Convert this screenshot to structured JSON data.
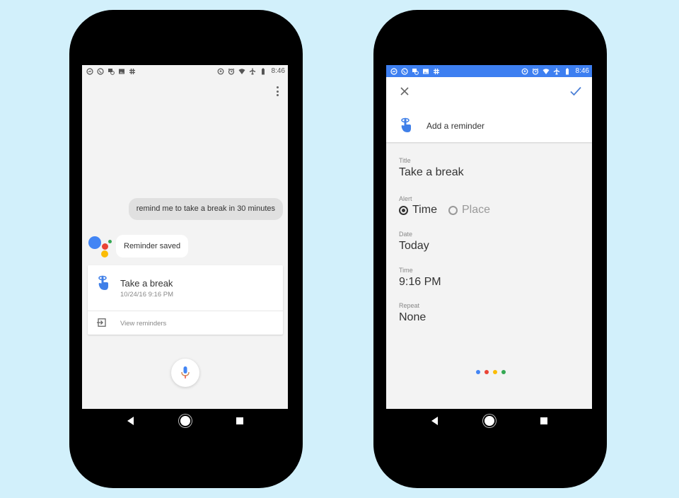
{
  "colors": {
    "background": "#d2f0fb",
    "status_bar_blue": "#3d7ff1",
    "google_blue": "#4285f4",
    "google_red": "#ea4335",
    "google_yellow": "#fbbc05",
    "google_green": "#34a853",
    "reminder_icon_blue": "#3f7fe8"
  },
  "left_phone": {
    "status_bar": {
      "left_icons": [
        "messenger-icon",
        "whatsapp-icon",
        "image-message-icon",
        "gallery-icon",
        "slack-icon"
      ],
      "right_icons": [
        "data-saver-icon",
        "alarm-icon",
        "wifi-icon",
        "airplane-icon",
        "battery-icon"
      ],
      "time": "8:46"
    },
    "conversation": {
      "user_query": "remind me to take a break in 30 minutes",
      "assistant_reply": "Reminder saved"
    },
    "reminder_card": {
      "icon": "reminder-hand-icon",
      "title": "Take a break",
      "datetime": "10/24/16 9:16 PM",
      "action_icon": "open-in-icon",
      "action_label": "View reminders"
    },
    "mic_icon": "microphone-icon",
    "nav": [
      "back",
      "home",
      "recents"
    ]
  },
  "right_phone": {
    "status_bar": {
      "left_icons": [
        "messenger-icon",
        "whatsapp-icon",
        "image-message-icon",
        "gallery-icon",
        "slack-icon"
      ],
      "right_icons": [
        "data-saver-icon",
        "alarm-icon",
        "wifi-icon",
        "airplane-icon",
        "battery-icon"
      ],
      "time": "8:46"
    },
    "dialog": {
      "close_icon": "close-icon",
      "save_icon": "check-icon",
      "header_icon": "reminder-hand-icon",
      "header_title": "Add a reminder"
    },
    "form": {
      "title": {
        "label": "Title",
        "value": "Take a break"
      },
      "alert": {
        "label": "Alert",
        "options": [
          {
            "label": "Time",
            "selected": true
          },
          {
            "label": "Place",
            "selected": false
          }
        ]
      },
      "date": {
        "label": "Date",
        "value": "Today"
      },
      "time": {
        "label": "Time",
        "value": "9:16 PM"
      },
      "repeat": {
        "label": "Repeat",
        "value": "None"
      }
    },
    "nav": [
      "back",
      "home",
      "recents"
    ]
  }
}
